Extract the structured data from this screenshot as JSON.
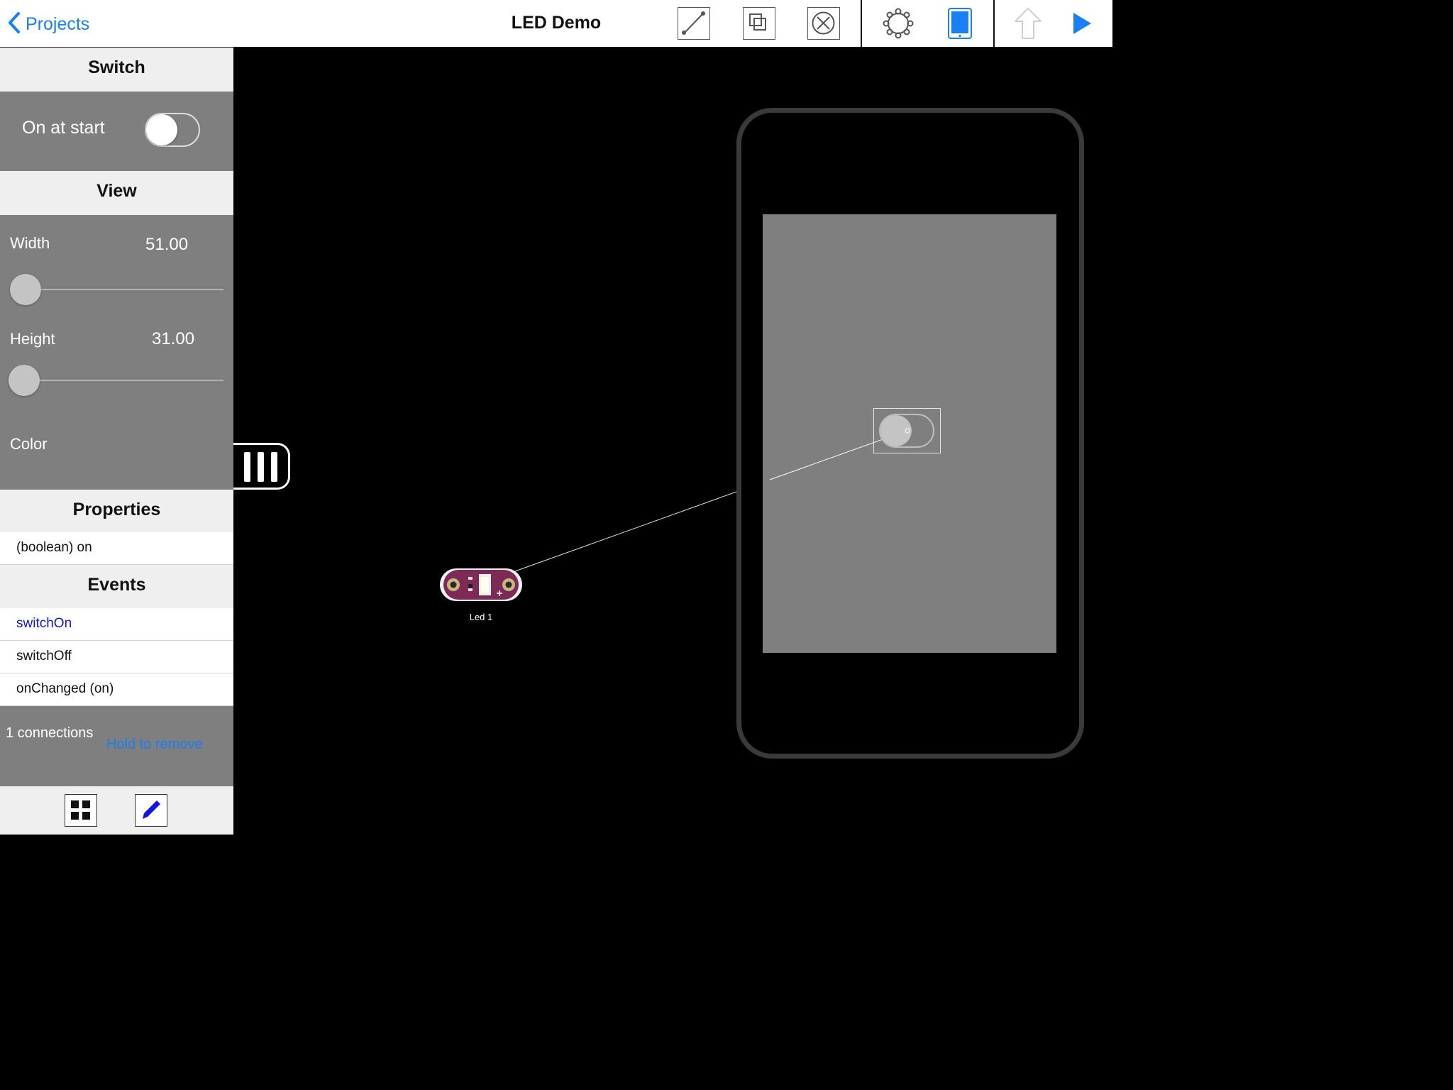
{
  "header": {
    "back_label": "Projects",
    "title": "LED Demo",
    "tools": {
      "connect_icon": "line-connect-icon",
      "duplicate_icon": "duplicate-icon",
      "delete_icon": "delete-x-icon",
      "settings_icon": "gear-icon",
      "device_icon": "tablet-icon",
      "upload_icon": "upload-arrow-icon",
      "run_icon": "play-icon"
    },
    "accent_color": "#1a7ef5"
  },
  "sidebar": {
    "switch_section": {
      "title": "Switch",
      "on_at_start_label": "On at start",
      "on_at_start_value": false
    },
    "view_section": {
      "title": "View",
      "width_label": "Width",
      "width_value": "51.00",
      "height_label": "Height",
      "height_value": "31.00",
      "color_label": "Color"
    },
    "properties_section": {
      "title": "Properties",
      "items": [
        "(boolean) on"
      ]
    },
    "events_section": {
      "title": "Events",
      "items": [
        "switchOn",
        "switchOff",
        "onChanged (on)"
      ],
      "selected_color": "#1515e0"
    },
    "connections": {
      "count_label": "1 connections",
      "remove_hint": "Hold to remove"
    },
    "bottom_bar": {
      "grid_icon": "grid-icon",
      "edit_icon": "pencil-icon"
    }
  },
  "canvas": {
    "led_label": "Led 1",
    "device_frame": "phone-outline",
    "switch_widget_state": "off"
  }
}
